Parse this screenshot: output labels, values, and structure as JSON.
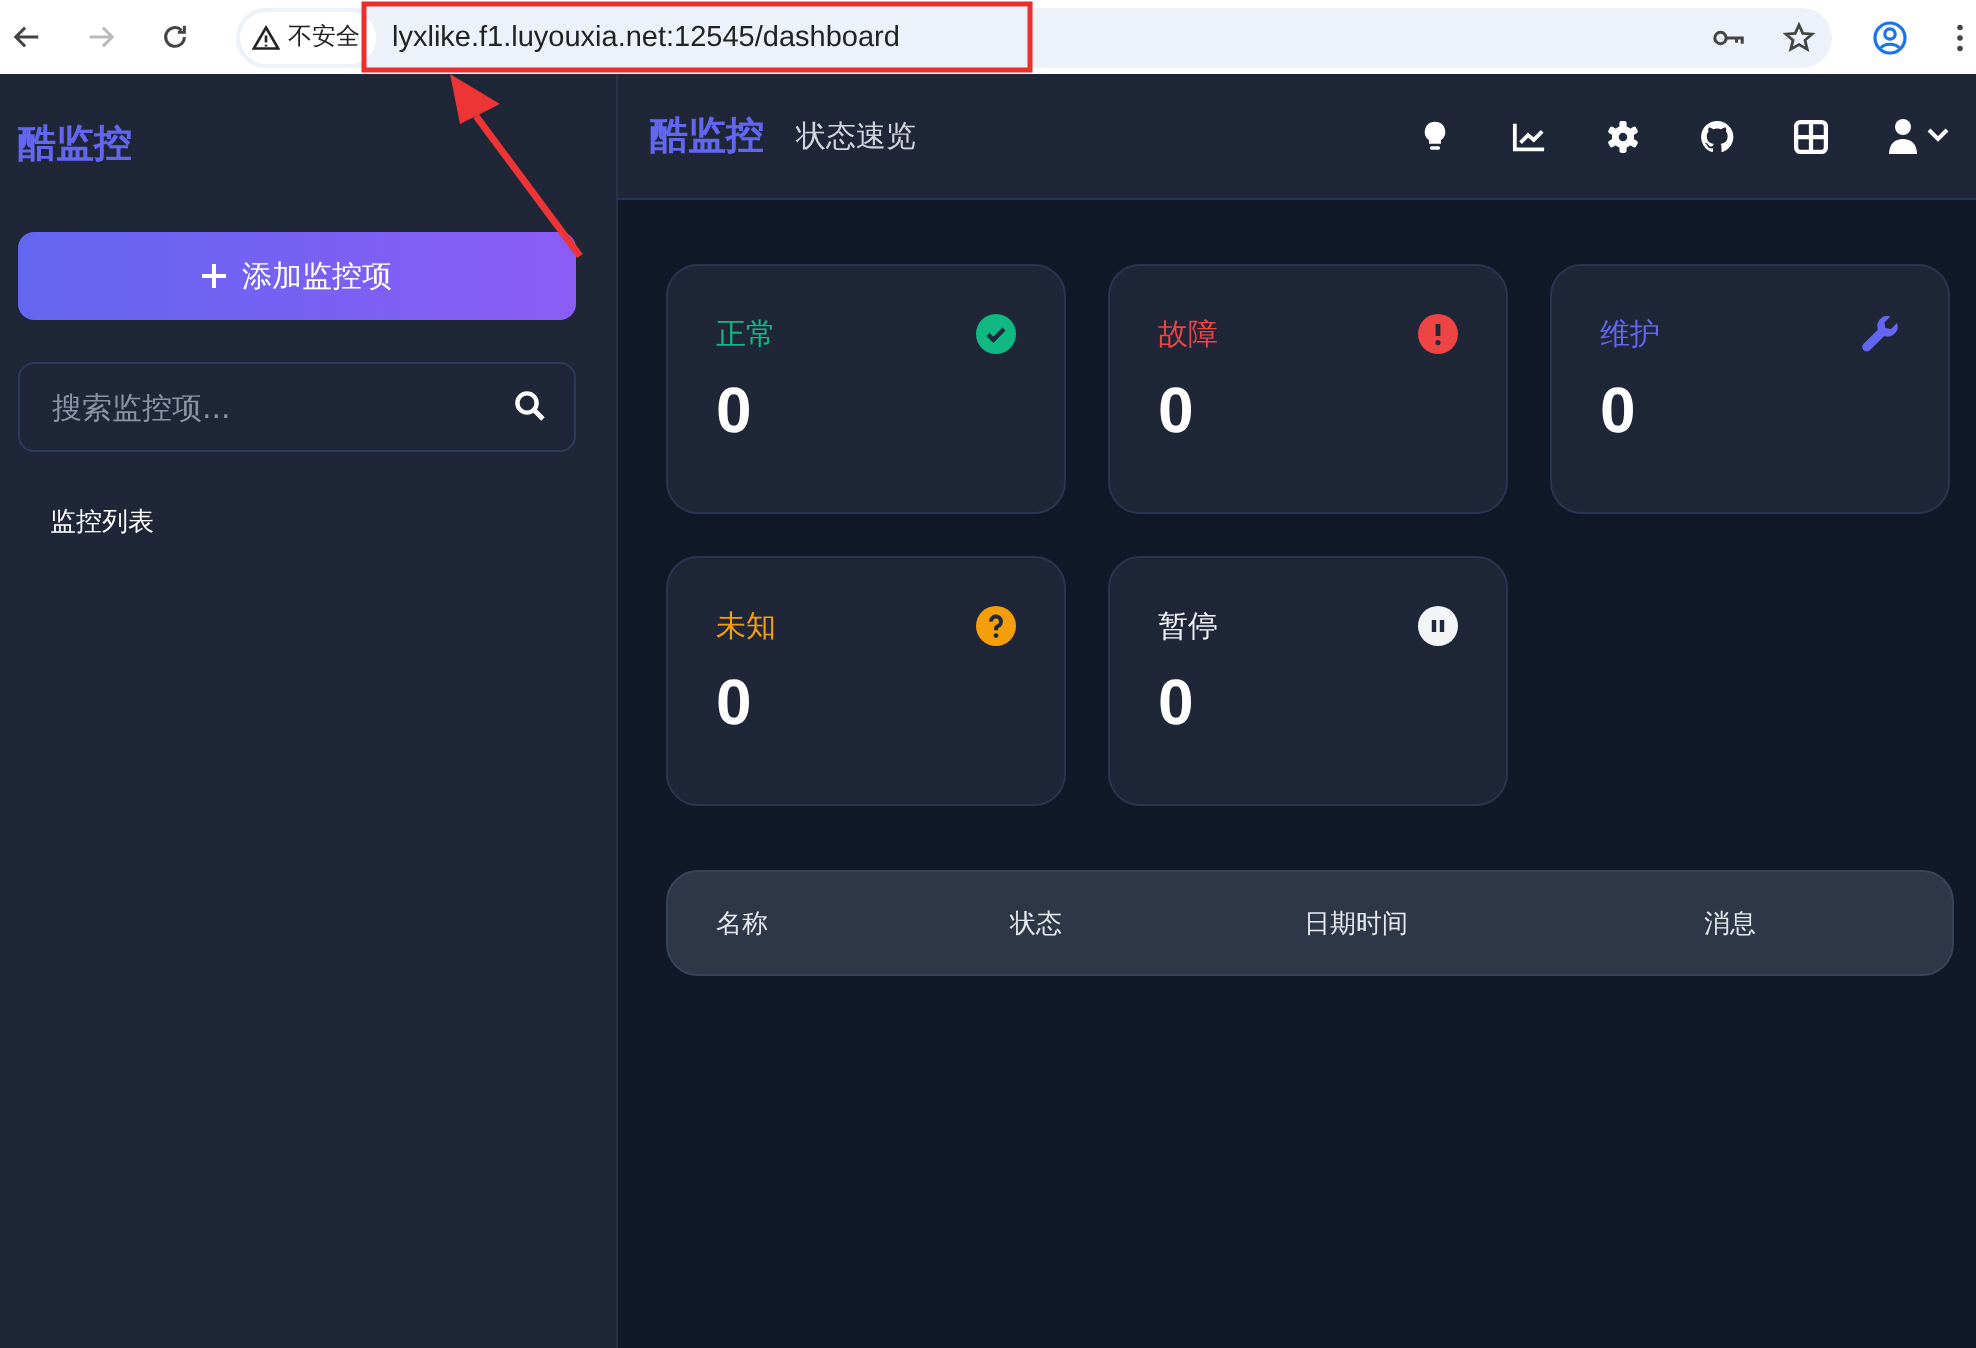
{
  "browser": {
    "security_label": "不安全",
    "url": "lyxlike.f1.luyouxia.net:12545/dashboard",
    "forward_disabled": true
  },
  "sidebar": {
    "brand": "酷监控",
    "add_button": "添加监控项",
    "search": {
      "placeholder": "搜索监控项..."
    },
    "list_title": "监控列表"
  },
  "header": {
    "brand": "酷监控",
    "title": "状态速览"
  },
  "cards": [
    {
      "kind": "up",
      "label": "正常",
      "count": "0",
      "color": "#10b981"
    },
    {
      "kind": "down",
      "label": "故障",
      "count": "0",
      "color": "#ef4444"
    },
    {
      "kind": "maintenance",
      "label": "维护",
      "count": "0",
      "color": "#6366f1"
    },
    {
      "kind": "unknown",
      "label": "未知",
      "count": "0",
      "color": "#f59e0b"
    },
    {
      "kind": "paused",
      "label": "暂停",
      "count": "0",
      "color": "#f3f4f6"
    }
  ],
  "table": {
    "columns": [
      "名称",
      "状态",
      "日期时间",
      "消息"
    ]
  }
}
